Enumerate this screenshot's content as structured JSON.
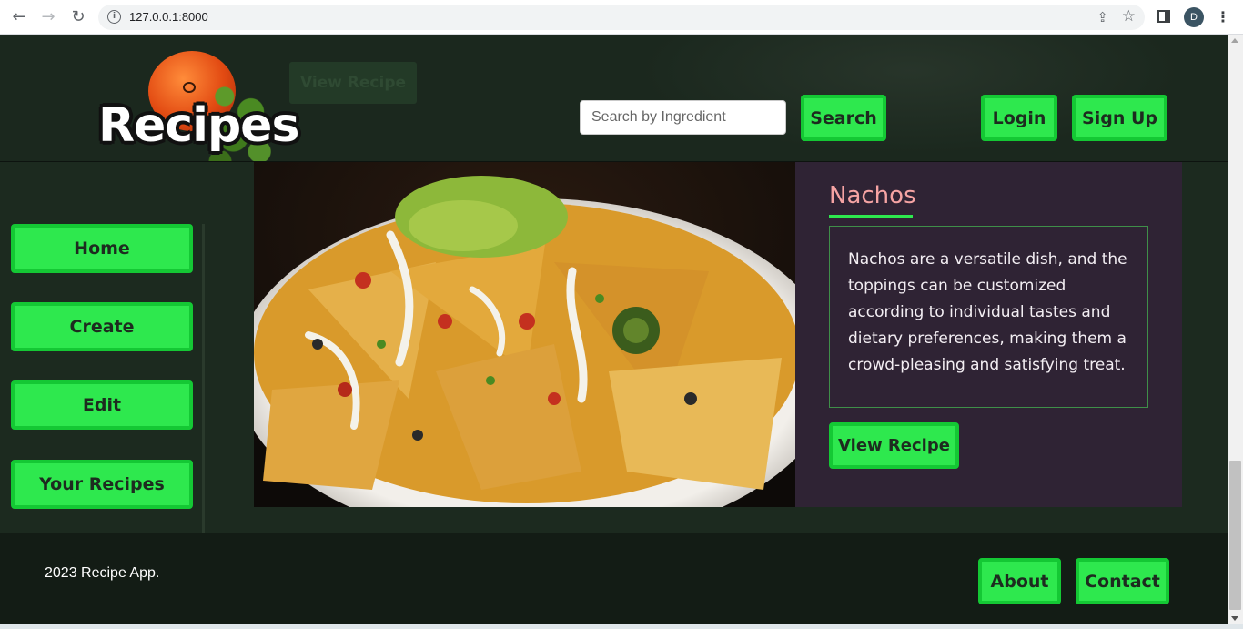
{
  "browser": {
    "url": "127.0.0.1:8000",
    "profile_initial": "D"
  },
  "header": {
    "logo_text": "Recipes",
    "ghost_button_label": "View Recipe",
    "search_placeholder": "Search by Ingredient",
    "search_button": "Search",
    "login_button": "Login",
    "signup_button": "Sign Up"
  },
  "sidebar": {
    "items": [
      {
        "label": "Home"
      },
      {
        "label": "Create"
      },
      {
        "label": "Edit"
      },
      {
        "label": "Your Recipes"
      }
    ]
  },
  "recipe": {
    "title": "Nachos",
    "description": "Nachos are a versatile dish, and the toppings can be customized according to individual tastes and dietary preferences, making them a crowd-pleasing and satisfying treat.",
    "view_button": "View Recipe"
  },
  "footer": {
    "copyright": "2023 Recipe App.",
    "about_button": "About",
    "contact_button": "Contact"
  },
  "colors": {
    "accent_green": "#2ee84e",
    "accent_green_border": "#14c834",
    "page_bg": "#1c2a1f",
    "card_bg": "#2f2334",
    "title_pink": "#f5a3a3"
  },
  "icons": {
    "back": "arrow-left-icon",
    "forward": "arrow-right-icon",
    "reload": "reload-icon",
    "info": "info-icon",
    "share": "share-icon",
    "bookmark": "star-icon",
    "side_panel": "side-panel-icon",
    "menu": "kebab-menu-icon"
  }
}
